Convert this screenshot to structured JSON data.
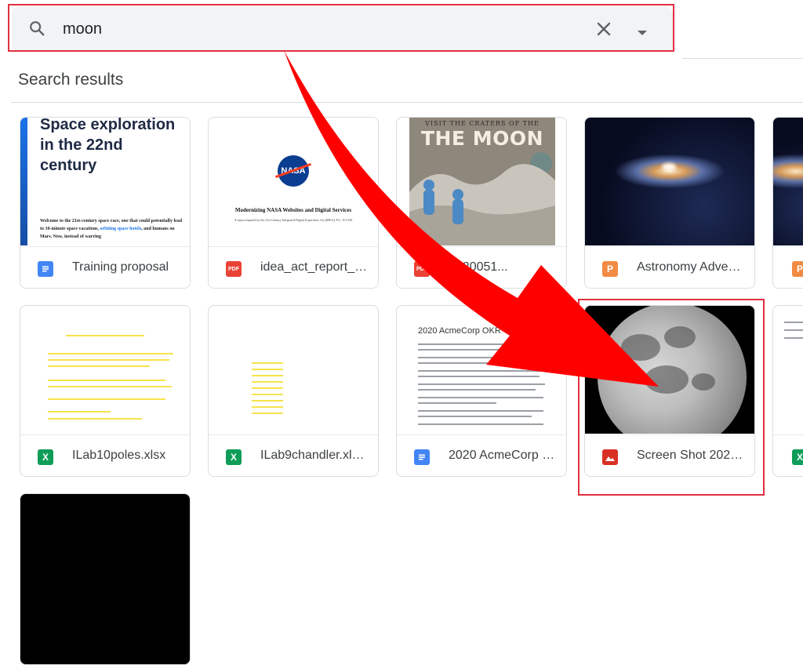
{
  "search": {
    "query": "moon"
  },
  "results": {
    "heading": "Search results",
    "items": [
      {
        "name": "Training proposal",
        "type": "doc"
      },
      {
        "name": "idea_act_report_to...",
        "type": "pdf"
      },
      {
        "name": "2020051...",
        "type": "pdf"
      },
      {
        "name": "Astronomy Advent...",
        "type": "slides"
      },
      {
        "name": "ILab10poles.xlsx",
        "type": "sheet"
      },
      {
        "name": "ILab9chandler.xlsx...",
        "type": "sheet"
      },
      {
        "name": "2020 AcmeCorp O...",
        "type": "doc"
      },
      {
        "name": "Screen Shot 2020-...",
        "type": "image"
      }
    ]
  },
  "previews": {
    "training": {
      "title": "Space exploration in the 22nd century",
      "body_1": "Welcome to the 21st-century space race, one that could potentially lead to 10-minute space vacations,",
      "body_link": "orbiting space hotels",
      "body_2": ", and humans on Mars. Now, instead of warring"
    },
    "nasa": {
      "logo": "NASA",
      "title": "Modernizing NASA Websites and Digital Services",
      "subtitle": "A report required by the 21st Century Integrated Digital Experience Act (IDEA), P.L. 115-336"
    },
    "moon_poster": {
      "line1": "VISIT THE CRATERS OF THE",
      "line2": "THE MOON"
    },
    "okr": {
      "title": "2020 AcmeCorp OKR"
    }
  },
  "icons": {
    "doc_color": "#4285f4",
    "pdf_color": "#ea4335",
    "slides_color": "#f4b400",
    "slides_orange": "#f28b43",
    "sheet_color": "#0f9d58",
    "image_color": "#d93025"
  },
  "annotation_color": "#ff0000"
}
